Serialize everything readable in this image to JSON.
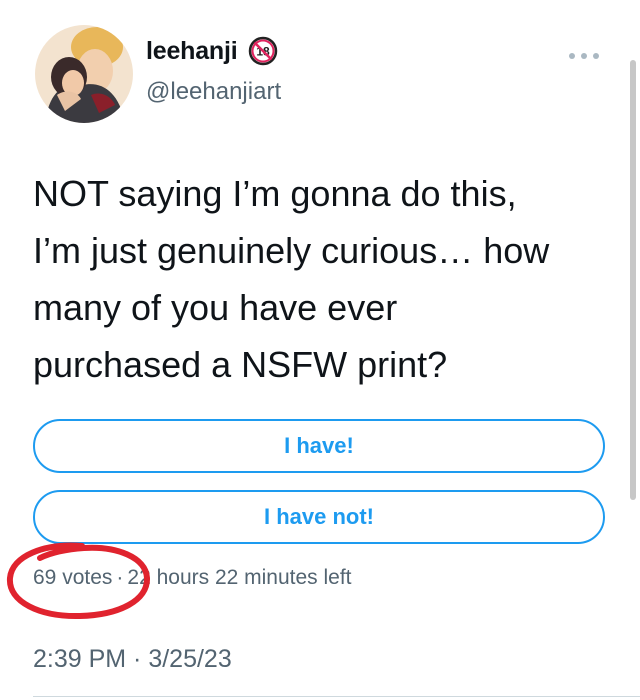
{
  "author": {
    "display_name": "leehanji",
    "handle": "@leehanjiart",
    "age_badge_text": "18"
  },
  "tweet": {
    "lines": [
      "NOT saying I’m gonna do this,",
      "I’m just genuinely curious… how",
      "many of you have ever",
      "purchased a NSFW print?"
    ]
  },
  "poll": {
    "options": [
      "I have!",
      "I have not!"
    ],
    "votes": "69 votes",
    "separator": "·",
    "time_left": "22 hours 22 minutes left"
  },
  "timestamp": "2:39 PM · 3/25/23",
  "colors": {
    "accent": "#1d9bf0",
    "secondary_text": "#536471",
    "highlight_circle": "#e0232e",
    "badge": "#e0245e"
  },
  "icons": {
    "more": "more-dots-icon",
    "age_restricted": "age-restricted-icon"
  }
}
